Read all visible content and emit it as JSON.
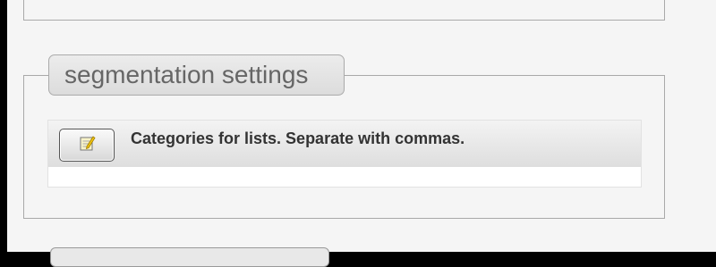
{
  "section": {
    "legend": "segmentation settings"
  },
  "field": {
    "description": "Categories for lists. Separate with commas.",
    "edit_icon": "edit-note-icon",
    "value": ""
  }
}
